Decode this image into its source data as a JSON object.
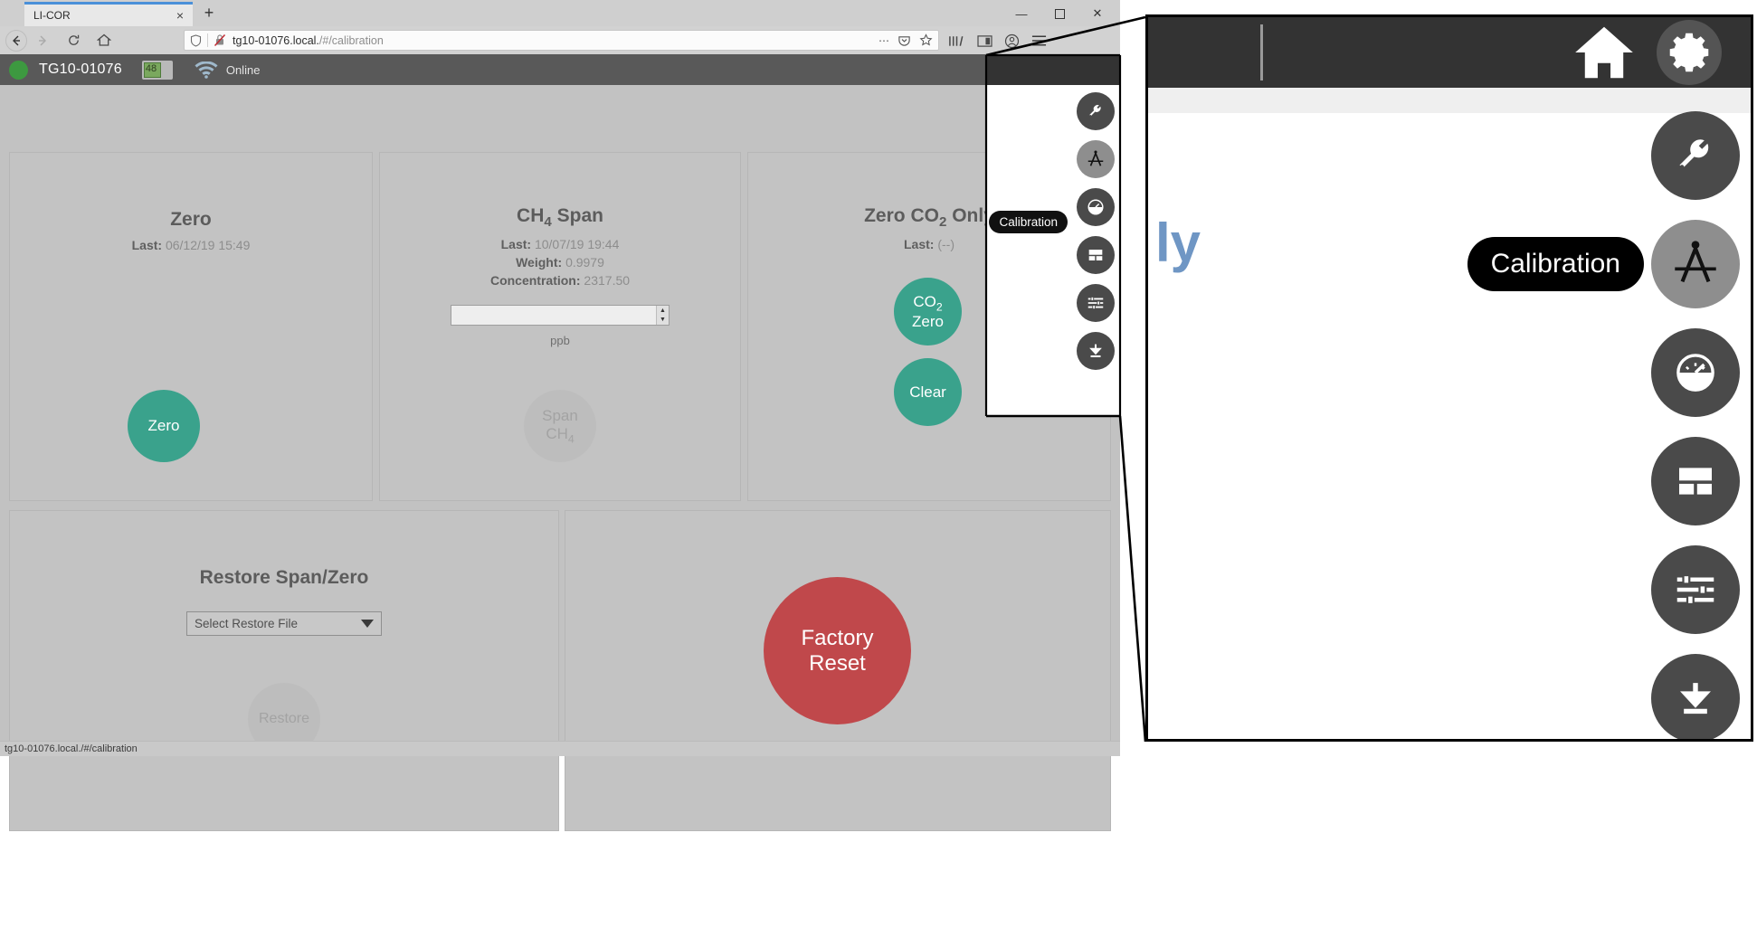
{
  "browser": {
    "tab_title": "LI-COR",
    "tab_close": "×",
    "new_tab": "+",
    "minimize": "—",
    "maximize": "☐",
    "close": "✕",
    "back_icon": "back-arrow-icon",
    "forward_icon": "forward-arrow-icon",
    "reload_icon": "reload-icon",
    "home_icon": "home-icon",
    "url_host": "tg10-01076.local.",
    "url_path": "/#/calibration",
    "shield_icon": "shield-icon",
    "lock_broken_icon": "lock-crossed-icon",
    "page_actions": "⋯",
    "pocket_icon": "pocket-icon",
    "bookmark_icon": "star-icon",
    "library_icon": "library-icon",
    "sidebar_icon": "sidebar-icon",
    "account_icon": "account-icon",
    "menu_icon": "hamburger-menu-icon",
    "statusbar_url": "tg10-01076.local./#/calibration"
  },
  "app": {
    "status_dot": "status-indicator-green",
    "device_name": "TG10-01076",
    "battery_percent": "48",
    "wifi_icon": "wifi-icon",
    "connection_status": "Online",
    "header_home_icon": "home-icon",
    "header_gear_icon": "gear-icon"
  },
  "panels": {
    "zero": {
      "title": "Zero",
      "last_label": "Last:",
      "last_value": "06/12/19 15:49",
      "button_label": "Zero"
    },
    "ch4_span": {
      "title_prefix": "CH",
      "title_sub": "4",
      "title_suffix": " Span",
      "last_label": "Last:",
      "last_value": "10/07/19 19:44",
      "weight_label": "Weight:",
      "weight_value": "0.9979",
      "concentration_label": "Concentration:",
      "concentration_value": "2317.50",
      "input_value": "",
      "input_placeholder": "",
      "unit": "ppb",
      "button_line1": "Span",
      "button_line2_prefix": "CH",
      "button_line2_sub": "4"
    },
    "zero_co2": {
      "title_prefix": "Zero CO",
      "title_sub": "2",
      "title_suffix": " Only",
      "last_label": "Last:",
      "last_value": "(--)",
      "co2_button_line1_prefix": "CO",
      "co2_button_line1_sub": "2",
      "co2_button_line2": "Zero",
      "clear_button_label": "Clear"
    },
    "restore": {
      "title": "Restore Span/Zero",
      "select_value": "Select Restore File",
      "caret_icon": "chevron-down-icon",
      "button_label": "Restore"
    },
    "factory": {
      "button_line1": "Factory",
      "button_line2": "Reset"
    }
  },
  "popup_menu": {
    "home_icon": "home-icon",
    "gear_icon": "gear-icon",
    "tooltip": "Calibration",
    "cursor_icon": "pointer-hand-cursor",
    "items": [
      {
        "icon": "wrench-icon",
        "name": "maintenance"
      },
      {
        "icon": "compass-divider-icon",
        "name": "calibration",
        "active": true
      },
      {
        "icon": "gauge-icon",
        "name": "diagnostics"
      },
      {
        "icon": "dashboard-layout-icon",
        "name": "layout"
      },
      {
        "icon": "sliders-icon",
        "name": "settings"
      },
      {
        "icon": "download-icon",
        "name": "download"
      }
    ]
  },
  "magnifier": {
    "tooltip": "Calibration",
    "ghost_text_1": "ly",
    "ghost_text_2": "y"
  },
  "colors": {
    "teal": "#3aa28c",
    "red": "#c0484b",
    "header_dark": "#595959",
    "header_darker": "#333333",
    "panel_bg": "#c3c3c3",
    "status_green": "#3d9940",
    "accent_blue": "#4a90d9"
  }
}
